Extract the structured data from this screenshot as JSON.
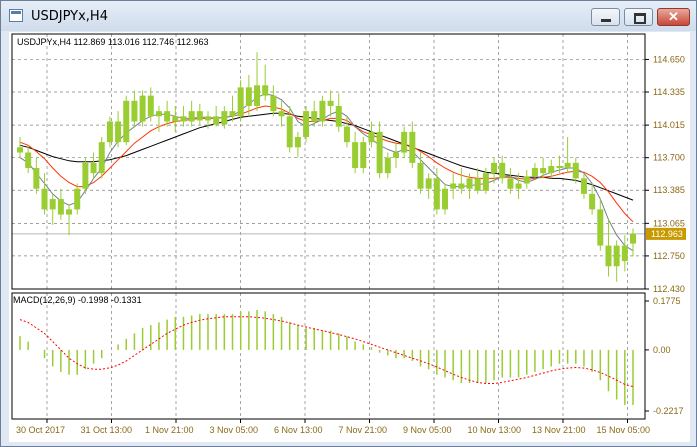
{
  "window": {
    "title": "USDJPYx,H4",
    "minimize_glyph": "",
    "maximize_glyph": "",
    "close_glyph": "✕",
    "icon": "chart-window-icon"
  },
  "colors": {
    "window_bg": "#dfe8f3",
    "chart_bg": "#ffffff",
    "frame": "#000000",
    "grid": "#808080",
    "candle": "#9acd32",
    "axis_text": "#8b6914",
    "ma_fast": "#708090",
    "ma_mid": "#ff3300",
    "ma_slow": "#000000",
    "macd_hist": "#9acd32",
    "macd_signal": "#ff0000",
    "price_tag_bg": "#c89a00"
  },
  "chart_data": [
    {
      "type": "candlestick",
      "title": "USDJPYx,H4  112.869 113.016 112.746 112.963",
      "symbol": "USDJPYx",
      "timeframe": "H4",
      "ohlc_last": {
        "open": 112.869,
        "high": 113.016,
        "low": 112.746,
        "close": 112.963
      },
      "current_price": "112.963",
      "y_ticks": [
        "114.650",
        "114.335",
        "114.015",
        "113.700",
        "113.385",
        "113.065",
        "112.750",
        "112.430"
      ],
      "ylim": [
        112.43,
        114.78
      ],
      "x_ticks": [
        "30 Oct 2017",
        "31 Oct 13:00",
        "1 Nov 21:00",
        "3 Nov 05:00",
        "6 Nov 13:00",
        "7 Nov 21:00",
        "9 Nov 05:00",
        "10 Nov 13:00",
        "13 Nov 21:00",
        "15 Nov 05:00"
      ],
      "grid": true,
      "candles": [
        [
          113.8,
          113.9,
          113.7,
          113.75
        ],
        [
          113.75,
          113.82,
          113.55,
          113.6
        ],
        [
          113.6,
          113.7,
          113.35,
          113.4
        ],
        [
          113.4,
          113.55,
          113.15,
          113.2
        ],
        [
          113.2,
          113.35,
          113.05,
          113.3
        ],
        [
          113.3,
          113.4,
          113.1,
          113.15
        ],
        [
          113.15,
          113.25,
          112.95,
          113.2
        ],
        [
          113.2,
          113.45,
          113.15,
          113.4
        ],
        [
          113.4,
          113.7,
          113.35,
          113.65
        ],
        [
          113.65,
          113.75,
          113.5,
          113.55
        ],
        [
          113.55,
          113.9,
          113.5,
          113.85
        ],
        [
          113.85,
          114.1,
          113.8,
          114.05
        ],
        [
          114.05,
          114.15,
          113.8,
          113.85
        ],
        [
          113.85,
          114.3,
          113.82,
          114.25
        ],
        [
          114.25,
          114.35,
          114.0,
          114.05
        ],
        [
          114.05,
          114.35,
          114.0,
          114.3
        ],
        [
          114.3,
          114.38,
          114.05,
          114.1
        ],
        [
          114.1,
          114.2,
          113.95,
          114.15
        ],
        [
          114.15,
          114.25,
          114.0,
          114.05
        ],
        [
          114.05,
          114.2,
          113.95,
          114.1
        ],
        [
          114.1,
          114.2,
          114.0,
          114.05
        ],
        [
          114.05,
          114.25,
          114.0,
          114.15
        ],
        [
          114.15,
          114.22,
          114.02,
          114.06
        ],
        [
          114.06,
          114.15,
          113.98,
          114.1
        ],
        [
          114.1,
          114.2,
          114.0,
          114.02
        ],
        [
          114.02,
          114.2,
          113.98,
          114.15
        ],
        [
          114.15,
          114.3,
          114.05,
          114.1
        ],
        [
          114.1,
          114.45,
          114.05,
          114.38
        ],
        [
          114.38,
          114.5,
          114.1,
          114.2
        ],
        [
          114.2,
          114.72,
          114.15,
          114.4
        ],
        [
          114.4,
          114.6,
          114.25,
          114.3
        ],
        [
          114.3,
          114.4,
          114.1,
          114.15
        ],
        [
          114.15,
          114.25,
          114.0,
          114.1
        ],
        [
          114.1,
          114.2,
          113.75,
          113.8
        ],
        [
          113.8,
          113.95,
          113.7,
          113.9
        ],
        [
          113.9,
          114.2,
          113.85,
          114.15
        ],
        [
          114.15,
          114.25,
          114.0,
          114.05
        ],
        [
          114.05,
          114.3,
          114.0,
          114.25
        ],
        [
          114.25,
          114.35,
          114.1,
          114.2
        ],
        [
          114.2,
          114.32,
          113.95,
          114.0
        ],
        [
          114.0,
          114.1,
          113.8,
          113.85
        ],
        [
          113.85,
          113.95,
          113.55,
          113.6
        ],
        [
          113.6,
          113.9,
          113.55,
          113.85
        ],
        [
          113.85,
          114.05,
          113.8,
          113.95
        ],
        [
          113.95,
          114.05,
          113.5,
          113.55
        ],
        [
          113.55,
          113.75,
          113.5,
          113.7
        ],
        [
          113.7,
          113.85,
          113.6,
          113.75
        ],
        [
          113.75,
          114.0,
          113.7,
          113.95
        ],
        [
          113.95,
          114.05,
          113.6,
          113.65
        ],
        [
          113.65,
          113.75,
          113.35,
          113.4
        ],
        [
          113.4,
          113.55,
          113.3,
          113.5
        ],
        [
          113.5,
          113.6,
          113.15,
          113.2
        ],
        [
          113.2,
          113.45,
          113.15,
          113.4
        ],
        [
          113.4,
          113.55,
          113.3,
          113.45
        ],
        [
          113.45,
          113.6,
          113.35,
          113.4
        ],
        [
          113.4,
          113.55,
          113.3,
          113.5
        ],
        [
          113.5,
          113.6,
          113.35,
          113.38
        ],
        [
          113.38,
          113.6,
          113.35,
          113.55
        ],
        [
          113.55,
          113.7,
          113.45,
          113.65
        ],
        [
          113.65,
          113.72,
          113.45,
          113.5
        ],
        [
          113.5,
          113.6,
          113.35,
          113.4
        ],
        [
          113.4,
          113.55,
          113.3,
          113.45
        ],
        [
          113.45,
          113.58,
          113.4,
          113.52
        ],
        [
          113.52,
          113.65,
          113.5,
          113.6
        ],
        [
          113.6,
          113.7,
          113.5,
          113.55
        ],
        [
          113.55,
          113.68,
          113.5,
          113.62
        ],
        [
          113.62,
          113.72,
          113.55,
          113.6
        ],
        [
          113.6,
          113.9,
          113.55,
          113.65
        ],
        [
          113.65,
          113.7,
          113.45,
          113.5
        ],
        [
          113.5,
          113.55,
          113.3,
          113.35
        ],
        [
          113.35,
          113.45,
          113.15,
          113.2
        ],
        [
          113.2,
          113.3,
          112.8,
          112.85
        ],
        [
          112.85,
          113.1,
          112.55,
          112.65
        ],
        [
          112.65,
          112.9,
          112.5,
          112.85
        ],
        [
          112.85,
          112.95,
          112.6,
          112.7
        ],
        [
          112.869,
          113.016,
          112.746,
          112.963
        ]
      ],
      "ma_fast": [
        113.7,
        113.65,
        113.55,
        113.45,
        113.35,
        113.28,
        113.24,
        113.27,
        113.38,
        113.5,
        113.6,
        113.75,
        113.86,
        113.94,
        114.0,
        114.06,
        114.1,
        114.12,
        114.12,
        114.1,
        114.08,
        114.08,
        114.09,
        114.09,
        114.08,
        114.09,
        114.1,
        114.16,
        114.22,
        114.28,
        114.32,
        114.3,
        114.26,
        114.18,
        114.05,
        114.0,
        114.03,
        114.07,
        114.12,
        114.15,
        114.1,
        114.0,
        113.93,
        113.88,
        113.82,
        113.78,
        113.75,
        113.78,
        113.76,
        113.68,
        113.6,
        113.52,
        113.44,
        113.42,
        113.42,
        113.43,
        113.44,
        113.45,
        113.48,
        113.52,
        113.52,
        113.48,
        113.46,
        113.49,
        113.53,
        113.56,
        113.58,
        113.6,
        113.6,
        113.55,
        113.45,
        113.3,
        113.1,
        112.95,
        112.85,
        112.8
      ],
      "ma_mid": [
        113.85,
        113.82,
        113.76,
        113.69,
        113.6,
        113.52,
        113.46,
        113.42,
        113.42,
        113.46,
        113.52,
        113.6,
        113.68,
        113.76,
        113.84,
        113.9,
        113.96,
        114.0,
        114.03,
        114.05,
        114.06,
        114.07,
        114.08,
        114.08,
        114.08,
        114.09,
        114.1,
        114.12,
        114.15,
        114.18,
        114.2,
        114.19,
        114.17,
        114.13,
        114.08,
        114.05,
        114.05,
        114.06,
        114.08,
        114.08,
        114.06,
        114.0,
        113.95,
        113.92,
        113.89,
        113.86,
        113.84,
        113.83,
        113.81,
        113.76,
        113.71,
        113.65,
        113.6,
        113.56,
        113.53,
        113.51,
        113.5,
        113.5,
        113.5,
        113.51,
        113.51,
        113.5,
        113.49,
        113.5,
        113.51,
        113.52,
        113.54,
        113.56,
        113.57,
        113.56,
        113.52,
        113.46,
        113.37,
        113.26,
        113.16,
        113.08
      ],
      "ma_slow": [
        113.82,
        113.8,
        113.77,
        113.74,
        113.71,
        113.69,
        113.67,
        113.66,
        113.66,
        113.66,
        113.67,
        113.68,
        113.7,
        113.72,
        113.75,
        113.78,
        113.81,
        113.84,
        113.87,
        113.9,
        113.93,
        113.96,
        113.99,
        114.01,
        114.03,
        114.05,
        114.07,
        114.09,
        114.1,
        114.11,
        114.12,
        114.13,
        114.13,
        114.12,
        114.1,
        114.09,
        114.08,
        114.07,
        114.06,
        114.05,
        114.03,
        114.01,
        113.98,
        113.95,
        113.92,
        113.89,
        113.86,
        113.83,
        113.8,
        113.77,
        113.74,
        113.71,
        113.68,
        113.65,
        113.62,
        113.6,
        113.58,
        113.56,
        113.55,
        113.54,
        113.53,
        113.52,
        113.51,
        113.51,
        113.51,
        113.5,
        113.5,
        113.49,
        113.48,
        113.46,
        113.44,
        113.41,
        113.38,
        113.35,
        113.32,
        113.29
      ]
    },
    {
      "type": "bar",
      "title": "MACD(12,26,9) -0.1998 -0.1331",
      "y_ticks": [
        "0.1775",
        "0.00",
        "-0.2217"
      ],
      "ylim": [
        -0.2217,
        0.1775
      ],
      "histogram": [
        0.05,
        0.03,
        0.0,
        -0.03,
        -0.06,
        -0.08,
        -0.09,
        -0.09,
        -0.07,
        -0.05,
        -0.03,
        0.0,
        0.02,
        0.04,
        0.06,
        0.08,
        0.09,
        0.1,
        0.11,
        0.12,
        0.12,
        0.125,
        0.13,
        0.13,
        0.13,
        0.13,
        0.13,
        0.14,
        0.14,
        0.145,
        0.14,
        0.13,
        0.12,
        0.1,
        0.09,
        0.08,
        0.08,
        0.07,
        0.07,
        0.06,
        0.05,
        0.03,
        0.02,
        0.01,
        -0.01,
        -0.02,
        -0.03,
        -0.03,
        -0.04,
        -0.06,
        -0.07,
        -0.09,
        -0.1,
        -0.11,
        -0.12,
        -0.12,
        -0.12,
        -0.12,
        -0.11,
        -0.1,
        -0.1,
        -0.1,
        -0.09,
        -0.08,
        -0.07,
        -0.06,
        -0.05,
        -0.05,
        -0.05,
        -0.06,
        -0.08,
        -0.11,
        -0.15,
        -0.18,
        -0.2,
        -0.2
      ],
      "signal": [
        0.11,
        0.1,
        0.08,
        0.06,
        0.03,
        0.0,
        -0.03,
        -0.05,
        -0.065,
        -0.07,
        -0.07,
        -0.065,
        -0.055,
        -0.04,
        -0.02,
        0.0,
        0.02,
        0.04,
        0.06,
        0.075,
        0.09,
        0.1,
        0.108,
        0.113,
        0.117,
        0.12,
        0.12,
        0.12,
        0.12,
        0.118,
        0.115,
        0.11,
        0.105,
        0.098,
        0.09,
        0.083,
        0.076,
        0.07,
        0.063,
        0.056,
        0.048,
        0.04,
        0.03,
        0.02,
        0.01,
        0.0,
        -0.01,
        -0.02,
        -0.03,
        -0.04,
        -0.05,
        -0.062,
        -0.075,
        -0.088,
        -0.1,
        -0.11,
        -0.118,
        -0.122,
        -0.122,
        -0.118,
        -0.112,
        -0.106,
        -0.1,
        -0.092,
        -0.084,
        -0.076,
        -0.07,
        -0.066,
        -0.064,
        -0.066,
        -0.072,
        -0.082,
        -0.095,
        -0.11,
        -0.125,
        -0.133
      ]
    }
  ]
}
